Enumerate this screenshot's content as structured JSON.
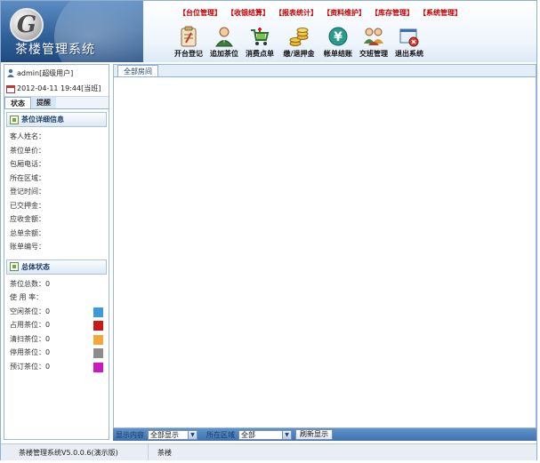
{
  "app": {
    "logo_letter": "G",
    "title": "茶楼管理系统"
  },
  "top_menu": [
    "【台位管理】",
    "【收银结算】",
    "【报表统计】",
    "【资料维护】",
    "【库存管理】",
    "【系统管理】"
  ],
  "toolbar": [
    {
      "label": "开台登记",
      "icon": "clipboard-icon"
    },
    {
      "label": "追加茶位",
      "icon": "person-icon"
    },
    {
      "label": "消费点单",
      "icon": "cart-icon"
    },
    {
      "label": "缴/退押金",
      "icon": "coins-icon"
    },
    {
      "label": "帐单结账",
      "icon": "yen-icon"
    },
    {
      "label": "交班管理",
      "icon": "users-icon"
    },
    {
      "label": "退出系统",
      "icon": "exit-icon"
    }
  ],
  "user": {
    "name": "admin[超级用户]",
    "datetime": "2012-04-11 19:44[当班]"
  },
  "left_tabs": {
    "status": "状态",
    "remind": "提醒"
  },
  "detail_section": {
    "title": "茶位详细信息",
    "fields": [
      "客人姓名：",
      "茶位单价：",
      "包厢电话：",
      "所在区域：",
      "登记时间：",
      "已交押金：",
      "应收金额：",
      "总单余额：",
      "账单编号："
    ]
  },
  "overall_section": {
    "title": "总体状态",
    "total": "茶位总数：0",
    "usage": "使 用 率：",
    "statuses": [
      {
        "label": "空闲茶位：0",
        "color": "#3d9ad8"
      },
      {
        "label": "占用茶位：0",
        "color": "#c81818"
      },
      {
        "label": "清扫茶位：0",
        "color": "#f2a73a"
      },
      {
        "label": "停用茶位：0",
        "color": "#8c8c8c"
      },
      {
        "label": "预订茶位：0",
        "color": "#cc18c0"
      }
    ]
  },
  "content": {
    "tab": "全部房间"
  },
  "filter": {
    "display_label": "显示内容",
    "display_value": "全部显示",
    "area_label": "所在区域",
    "area_value": "全部",
    "refresh": "刷新显示"
  },
  "statusbar": {
    "version": "茶楼管理系统V5.0.0.6(演示版)",
    "name": "茶楼"
  }
}
